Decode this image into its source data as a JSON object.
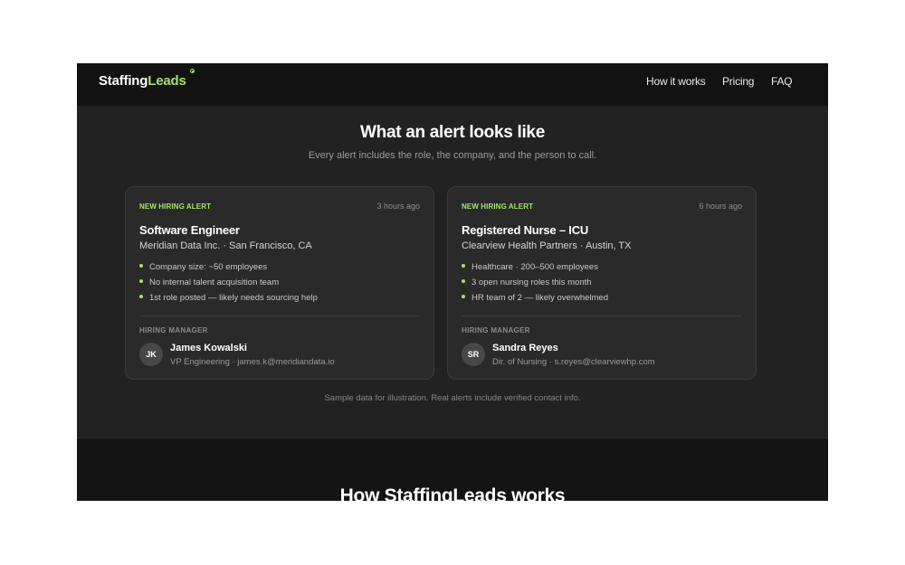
{
  "nav": {
    "logo_part1": "Staffing",
    "logo_part2": "Leads",
    "links": [
      "How it works",
      "Pricing",
      "FAQ"
    ]
  },
  "section": {
    "title": "What an alert looks like",
    "subtitle": "Every alert includes the role, the company, and the person to call."
  },
  "alerts": [
    {
      "badge": "NEW HIRING ALERT",
      "time": "3 hours ago",
      "role": "Software Engineer",
      "company": "Meridian Data Inc. · San Francisco, CA",
      "facts": [
        "Company size: ~50 employees",
        "No internal talent acquisition team",
        "1st role posted — likely needs sourcing help"
      ],
      "manager_label": "HIRING MANAGER",
      "initials": "JK",
      "manager_name": "James Kowalski",
      "manager_detail": "VP Engineering · james.k@meridiandata.io"
    },
    {
      "badge": "NEW HIRING ALERT",
      "time": "6 hours ago",
      "role": "Registered Nurse – ICU",
      "company": "Clearview Health Partners · Austin, TX",
      "facts": [
        "Healthcare · 200–500 employees",
        "3 open nursing roles this month",
        "HR team of 2 — likely overwhelmed"
      ],
      "manager_label": "HIRING MANAGER",
      "initials": "SR",
      "manager_name": "Sandra Reyes",
      "manager_detail": "Dir. of Nursing · s.reyes@clearviewhp.com"
    }
  ],
  "footnote": "Sample data for illustration. Real alerts include verified contact info.",
  "next_section": {
    "title": "How StaffingLeads works"
  },
  "colors": {
    "accent": "#a3e36a",
    "background": "#222222",
    "nav_background": "#121212"
  }
}
